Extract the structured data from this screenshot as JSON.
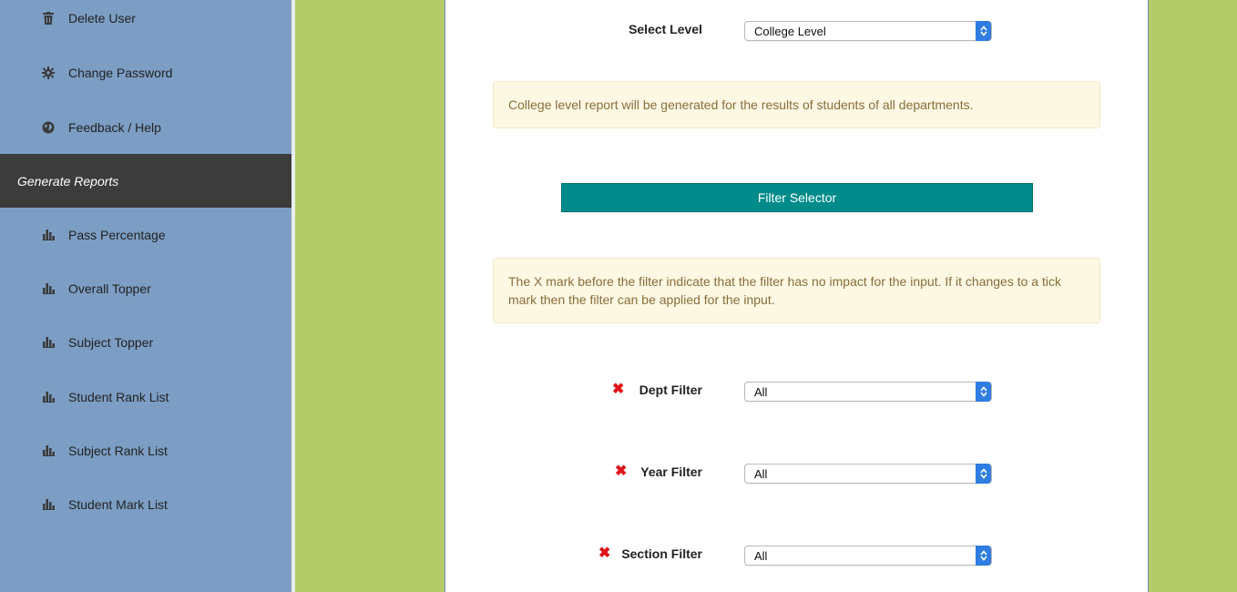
{
  "sidebar": {
    "top_items": [
      {
        "label": "Delete User",
        "icon": "trash-icon"
      },
      {
        "label": "Change Password",
        "icon": "gear-icon"
      },
      {
        "label": "Feedback / Help",
        "icon": "globe-icon"
      }
    ],
    "section_title": "Generate Reports",
    "report_items": [
      {
        "label": "Pass Percentage",
        "icon": "bar-chart-icon"
      },
      {
        "label": "Overall Topper",
        "icon": "bar-chart-icon"
      },
      {
        "label": "Subject Topper",
        "icon": "bar-chart-icon"
      },
      {
        "label": "Student Rank List",
        "icon": "bar-chart-icon"
      },
      {
        "label": "Subject Rank List",
        "icon": "bar-chart-icon"
      },
      {
        "label": "Student Mark List",
        "icon": "bar-chart-icon"
      }
    ]
  },
  "form": {
    "select_level_label": "Select Level",
    "select_level_value": "College Level",
    "level_info": "College level report will be generated for the results of students of all departments.",
    "filter_selector_label": "Filter Selector",
    "filter_info": "The X mark before the filter indicate that the filter has no impact for the input. If it changes to a tick mark then the filter can be applied for the input.",
    "filters": [
      {
        "label": "Dept Filter",
        "value": "All",
        "status": "x-mark"
      },
      {
        "label": "Year Filter",
        "value": "All",
        "status": "x-mark"
      },
      {
        "label": "Section Filter",
        "value": "All",
        "status": "x-mark"
      }
    ]
  },
  "colors": {
    "sidebar_bg": "#7c9ec4",
    "section_header_bg": "#3c3c3c",
    "page_bg": "#b4cc68",
    "filter_bar_bg": "#008b8b",
    "alert_bg": "#fcf8e3",
    "alert_text": "#8a6d3b",
    "x_mark": "#e0141a"
  }
}
